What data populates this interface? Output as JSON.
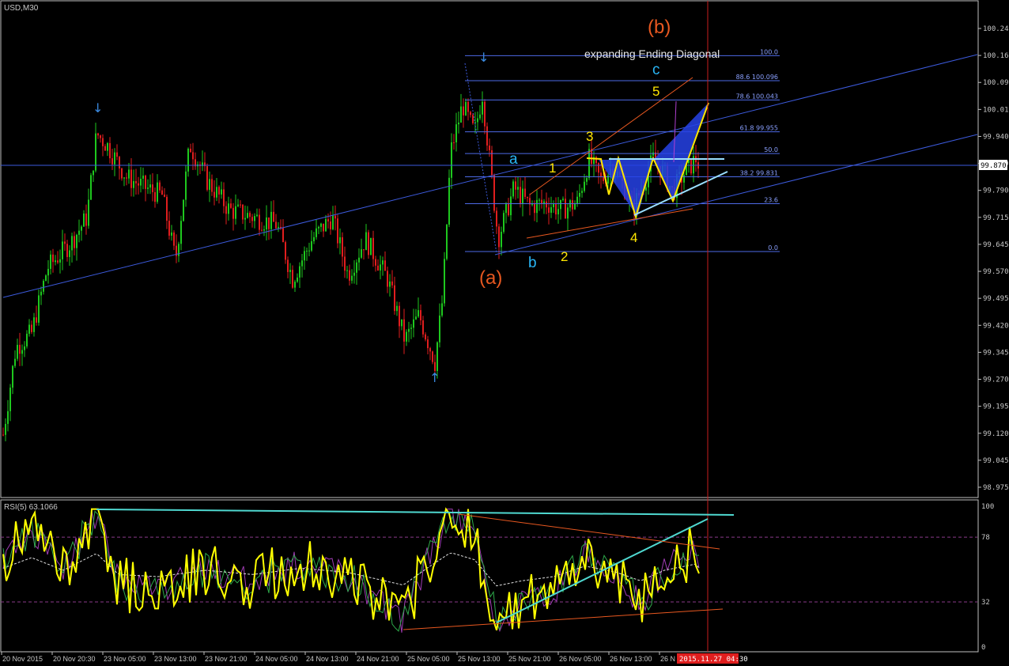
{
  "window": {
    "symbol_label": "USD,M30"
  },
  "colors": {
    "bg": "#000000",
    "frame": "#c0c0c0",
    "axis_text": "#c8c8c8",
    "bull": "#1ec81e",
    "bear": "#e01e1e",
    "trend_blue": "#3c5adc",
    "fib_blue": "#4d6ae6",
    "wave_yellow": "#ffe600",
    "wave_cyan": "#29b6f6",
    "wave_orange": "#e85820",
    "cur_time_line": "#c81e1e",
    "rsi_yellow": "#ffff00",
    "rsi_green": "#2ea84a",
    "rsi_purple": "#a03cb4",
    "rsi_cyan": "#4fd8d0",
    "rsi_orange": "#e85820",
    "rsi_level": "#8a3a8a"
  },
  "price_axis": {
    "ticks": [
      "100.240",
      "100.165",
      "100.090",
      "100.015",
      "99.940",
      "99.870",
      "99.790",
      "99.715",
      "99.645",
      "99.570",
      "99.495",
      "99.420",
      "99.345",
      "99.270",
      "99.195",
      "99.120",
      "99.045",
      "98.975"
    ],
    "current_price": "99.870"
  },
  "time_axis": {
    "ticks": [
      "20 Nov 2015",
      "20 Nov 20:30",
      "23 Nov 05:00",
      "23 Nov 13:00",
      "23 Nov 21:00",
      "24 Nov 05:00",
      "24 Nov 13:00",
      "24 Nov 21:00",
      "25 Nov 05:00",
      "25 Nov 13:00",
      "25 Nov 21:00",
      "26 Nov 05:00",
      "26 Nov 13:00",
      "26 N"
    ],
    "current_time": "2015.11.27 04:30"
  },
  "fibonacci": {
    "levels": [
      {
        "ratio": "100.0",
        "label": "100.0",
        "price": 100.165
      },
      {
        "ratio": "88.6",
        "label": "88.6 100.096",
        "price": 100.096
      },
      {
        "ratio": "78.6",
        "label": "78.6 100.043",
        "price": 100.043
      },
      {
        "ratio": "61.8",
        "label": "61.8 99.955",
        "price": 99.955
      },
      {
        "ratio": "50.0",
        "label": "50.0",
        "price": 99.895
      },
      {
        "ratio": "38.2",
        "label": "38.2 99.831",
        "price": 99.831
      },
      {
        "ratio": "23.6",
        "label": "23.6",
        "price": 99.757
      },
      {
        "ratio": "0.0",
        "label": "0.0",
        "price": 99.625
      }
    ]
  },
  "annotations": {
    "pattern_title": "expanding Ending Diagonal",
    "wave_b_big": "(b)",
    "wave_a_big": "(a)",
    "wave_a": "a",
    "wave_b": "b",
    "wave_c": "c",
    "wave_1": "1",
    "wave_2": "2",
    "wave_3": "3",
    "wave_4": "4",
    "wave_5": "5"
  },
  "rsi_panel": {
    "label": "RSI(5) 63.1066",
    "ticks": [
      "100",
      "78",
      "32",
      "0"
    ],
    "levels": [
      78,
      32
    ]
  },
  "chart_data": {
    "type": "candlestick",
    "symbol": "USD",
    "timeframe": "M30",
    "ylim": [
      98.94,
      100.27
    ],
    "key_points": [
      {
        "label": "swing high",
        "x": "20 Nov 20:30",
        "price": 100.02
      },
      {
        "label": "swing low",
        "x": "25 Nov 05:00",
        "price": 99.3
      },
      {
        "label": "swing high",
        "x": "25 Nov 13:00",
        "price": 100.165
      },
      {
        "label": "wave (a) low",
        "x": "25 Nov 13:00",
        "price": 99.625
      },
      {
        "label": "current",
        "x": "2015.11.27 04:30",
        "price": 99.87
      }
    ],
    "rsi": {
      "period": 5,
      "last": 63.1066,
      "ylim": [
        0,
        100
      ],
      "levels": [
        78,
        32
      ]
    }
  }
}
